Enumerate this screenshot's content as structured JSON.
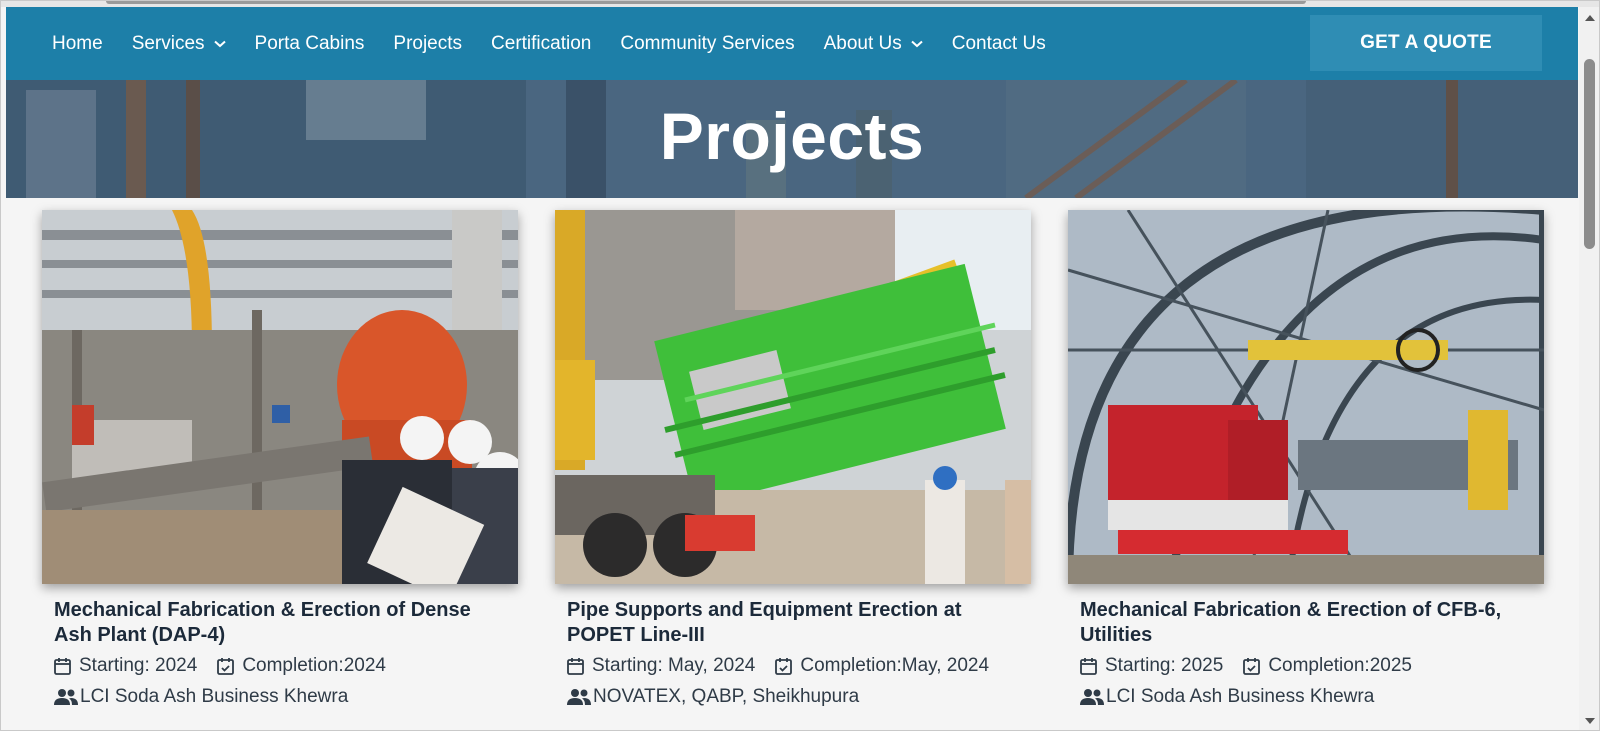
{
  "nav": {
    "items": [
      {
        "label": "Home",
        "has_dropdown": false
      },
      {
        "label": "Services",
        "has_dropdown": true
      },
      {
        "label": "Porta Cabins",
        "has_dropdown": false
      },
      {
        "label": "Projects",
        "has_dropdown": false
      },
      {
        "label": "Certification",
        "has_dropdown": false
      },
      {
        "label": "Community Services",
        "has_dropdown": false
      },
      {
        "label": "About Us",
        "has_dropdown": true
      },
      {
        "label": "Contact Us",
        "has_dropdown": false
      }
    ],
    "cta_label": "GET A QUOTE"
  },
  "hero": {
    "title": "Projects"
  },
  "projects": [
    {
      "title": "Mechanical Fabrication & Erection of Dense Ash Plant (DAP-4)",
      "starting": "Starting: 2024",
      "completion": "Completion:2024",
      "client": "LCI Soda Ash Business Khewra"
    },
    {
      "title": "Pipe Supports and Equipment Erection at POPET Line-III",
      "starting": "Starting: May, 2024",
      "completion": "Completion:May, 2024",
      "client": "NOVATEX, QABP, Sheikhupura"
    },
    {
      "title": "Mechanical Fabrication & Erection of CFB-6, Utilities",
      "starting": "Starting: 2025",
      "completion": "Completion:2025",
      "client": "LCI Soda Ash Business Khewra"
    }
  ],
  "colors": {
    "nav_bg": "#1d7fa8",
    "cta_bg": "#2f8db4",
    "title_text": "#1c2a3a"
  },
  "icons": {
    "calendar": "calendar-icon",
    "calendar_check": "calendar-check-icon",
    "users": "users-icon",
    "chevron": "chevron-down-icon"
  }
}
